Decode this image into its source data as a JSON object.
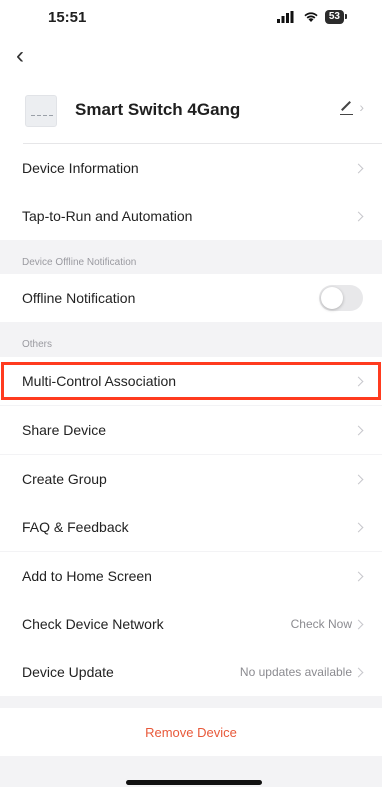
{
  "status_bar": {
    "time": "15:51",
    "signal": "…!!",
    "wifi": "◥",
    "battery": "53"
  },
  "header": {
    "device_name": "Smart Switch 4Gang"
  },
  "menu": {
    "device_information": "Device Information",
    "tap_to_run": "Tap-to-Run and Automation",
    "offline_section": "Device Offline Notification",
    "offline_notification": "Offline Notification",
    "offline_notification_on": false,
    "others_section": "Others",
    "multi_control": "Multi-Control Association",
    "share_device": "Share Device",
    "create_group": "Create Group",
    "faq": "FAQ & Feedback",
    "add_home": "Add to Home Screen",
    "check_network": "Check Device Network",
    "check_network_value": "Check Now",
    "device_update": "Device Update",
    "device_update_value": "No updates available",
    "remove_device": "Remove Device"
  },
  "colors": {
    "highlight": "#ff3b1f",
    "remove": "#e8593a"
  }
}
